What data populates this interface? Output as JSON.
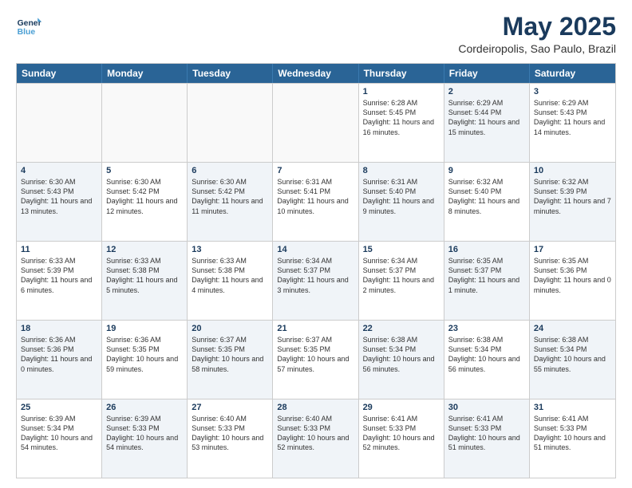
{
  "header": {
    "logo_line1": "General",
    "logo_line2": "Blue",
    "month": "May 2025",
    "location": "Cordeiropolis, Sao Paulo, Brazil"
  },
  "days_of_week": [
    "Sunday",
    "Monday",
    "Tuesday",
    "Wednesday",
    "Thursday",
    "Friday",
    "Saturday"
  ],
  "weeks": [
    [
      {
        "day": "",
        "text": "",
        "shaded": false,
        "empty": true
      },
      {
        "day": "",
        "text": "",
        "shaded": false,
        "empty": true
      },
      {
        "day": "",
        "text": "",
        "shaded": false,
        "empty": true
      },
      {
        "day": "",
        "text": "",
        "shaded": false,
        "empty": true
      },
      {
        "day": "1",
        "text": "Sunrise: 6:28 AM\nSunset: 5:45 PM\nDaylight: 11 hours\nand 16 minutes.",
        "shaded": false,
        "empty": false
      },
      {
        "day": "2",
        "text": "Sunrise: 6:29 AM\nSunset: 5:44 PM\nDaylight: 11 hours\nand 15 minutes.",
        "shaded": true,
        "empty": false
      },
      {
        "day": "3",
        "text": "Sunrise: 6:29 AM\nSunset: 5:43 PM\nDaylight: 11 hours\nand 14 minutes.",
        "shaded": false,
        "empty": false
      }
    ],
    [
      {
        "day": "4",
        "text": "Sunrise: 6:30 AM\nSunset: 5:43 PM\nDaylight: 11 hours\nand 13 minutes.",
        "shaded": true,
        "empty": false
      },
      {
        "day": "5",
        "text": "Sunrise: 6:30 AM\nSunset: 5:42 PM\nDaylight: 11 hours\nand 12 minutes.",
        "shaded": false,
        "empty": false
      },
      {
        "day": "6",
        "text": "Sunrise: 6:30 AM\nSunset: 5:42 PM\nDaylight: 11 hours\nand 11 minutes.",
        "shaded": true,
        "empty": false
      },
      {
        "day": "7",
        "text": "Sunrise: 6:31 AM\nSunset: 5:41 PM\nDaylight: 11 hours\nand 10 minutes.",
        "shaded": false,
        "empty": false
      },
      {
        "day": "8",
        "text": "Sunrise: 6:31 AM\nSunset: 5:40 PM\nDaylight: 11 hours\nand 9 minutes.",
        "shaded": true,
        "empty": false
      },
      {
        "day": "9",
        "text": "Sunrise: 6:32 AM\nSunset: 5:40 PM\nDaylight: 11 hours\nand 8 minutes.",
        "shaded": false,
        "empty": false
      },
      {
        "day": "10",
        "text": "Sunrise: 6:32 AM\nSunset: 5:39 PM\nDaylight: 11 hours\nand 7 minutes.",
        "shaded": true,
        "empty": false
      }
    ],
    [
      {
        "day": "11",
        "text": "Sunrise: 6:33 AM\nSunset: 5:39 PM\nDaylight: 11 hours\nand 6 minutes.",
        "shaded": false,
        "empty": false
      },
      {
        "day": "12",
        "text": "Sunrise: 6:33 AM\nSunset: 5:38 PM\nDaylight: 11 hours\nand 5 minutes.",
        "shaded": true,
        "empty": false
      },
      {
        "day": "13",
        "text": "Sunrise: 6:33 AM\nSunset: 5:38 PM\nDaylight: 11 hours\nand 4 minutes.",
        "shaded": false,
        "empty": false
      },
      {
        "day": "14",
        "text": "Sunrise: 6:34 AM\nSunset: 5:37 PM\nDaylight: 11 hours\nand 3 minutes.",
        "shaded": true,
        "empty": false
      },
      {
        "day": "15",
        "text": "Sunrise: 6:34 AM\nSunset: 5:37 PM\nDaylight: 11 hours\nand 2 minutes.",
        "shaded": false,
        "empty": false
      },
      {
        "day": "16",
        "text": "Sunrise: 6:35 AM\nSunset: 5:37 PM\nDaylight: 11 hours\nand 1 minute.",
        "shaded": true,
        "empty": false
      },
      {
        "day": "17",
        "text": "Sunrise: 6:35 AM\nSunset: 5:36 PM\nDaylight: 11 hours\nand 0 minutes.",
        "shaded": false,
        "empty": false
      }
    ],
    [
      {
        "day": "18",
        "text": "Sunrise: 6:36 AM\nSunset: 5:36 PM\nDaylight: 11 hours\nand 0 minutes.",
        "shaded": true,
        "empty": false
      },
      {
        "day": "19",
        "text": "Sunrise: 6:36 AM\nSunset: 5:35 PM\nDaylight: 10 hours\nand 59 minutes.",
        "shaded": false,
        "empty": false
      },
      {
        "day": "20",
        "text": "Sunrise: 6:37 AM\nSunset: 5:35 PM\nDaylight: 10 hours\nand 58 minutes.",
        "shaded": true,
        "empty": false
      },
      {
        "day": "21",
        "text": "Sunrise: 6:37 AM\nSunset: 5:35 PM\nDaylight: 10 hours\nand 57 minutes.",
        "shaded": false,
        "empty": false
      },
      {
        "day": "22",
        "text": "Sunrise: 6:38 AM\nSunset: 5:34 PM\nDaylight: 10 hours\nand 56 minutes.",
        "shaded": true,
        "empty": false
      },
      {
        "day": "23",
        "text": "Sunrise: 6:38 AM\nSunset: 5:34 PM\nDaylight: 10 hours\nand 56 minutes.",
        "shaded": false,
        "empty": false
      },
      {
        "day": "24",
        "text": "Sunrise: 6:38 AM\nSunset: 5:34 PM\nDaylight: 10 hours\nand 55 minutes.",
        "shaded": true,
        "empty": false
      }
    ],
    [
      {
        "day": "25",
        "text": "Sunrise: 6:39 AM\nSunset: 5:34 PM\nDaylight: 10 hours\nand 54 minutes.",
        "shaded": false,
        "empty": false
      },
      {
        "day": "26",
        "text": "Sunrise: 6:39 AM\nSunset: 5:33 PM\nDaylight: 10 hours\nand 54 minutes.",
        "shaded": true,
        "empty": false
      },
      {
        "day": "27",
        "text": "Sunrise: 6:40 AM\nSunset: 5:33 PM\nDaylight: 10 hours\nand 53 minutes.",
        "shaded": false,
        "empty": false
      },
      {
        "day": "28",
        "text": "Sunrise: 6:40 AM\nSunset: 5:33 PM\nDaylight: 10 hours\nand 52 minutes.",
        "shaded": true,
        "empty": false
      },
      {
        "day": "29",
        "text": "Sunrise: 6:41 AM\nSunset: 5:33 PM\nDaylight: 10 hours\nand 52 minutes.",
        "shaded": false,
        "empty": false
      },
      {
        "day": "30",
        "text": "Sunrise: 6:41 AM\nSunset: 5:33 PM\nDaylight: 10 hours\nand 51 minutes.",
        "shaded": true,
        "empty": false
      },
      {
        "day": "31",
        "text": "Sunrise: 6:41 AM\nSunset: 5:33 PM\nDaylight: 10 hours\nand 51 minutes.",
        "shaded": false,
        "empty": false
      }
    ]
  ]
}
